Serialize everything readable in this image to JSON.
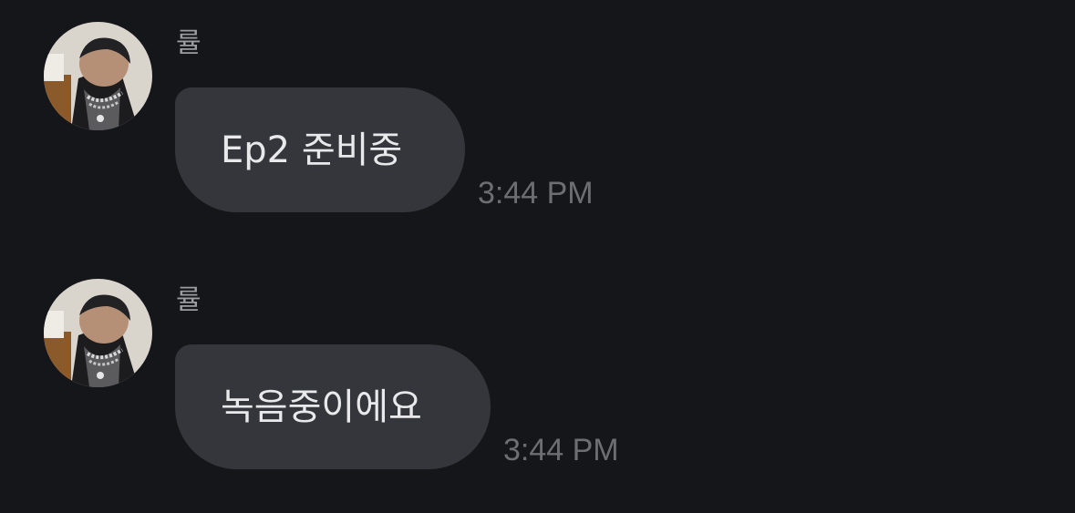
{
  "conversation": {
    "messages": [
      {
        "sender": "률",
        "avatar_icon": "profile-photo",
        "text": "Ep2 준비중",
        "time": "3:44 PM"
      },
      {
        "sender": "률",
        "avatar_icon": "profile-photo",
        "text": "녹음중이에요",
        "time": "3:44 PM"
      }
    ]
  },
  "colors": {
    "background": "#15161a",
    "bubble": "#35363b",
    "message_text": "#e9e9eb",
    "sender_name": "#9c9ca1",
    "timestamp": "#6d6e73"
  }
}
